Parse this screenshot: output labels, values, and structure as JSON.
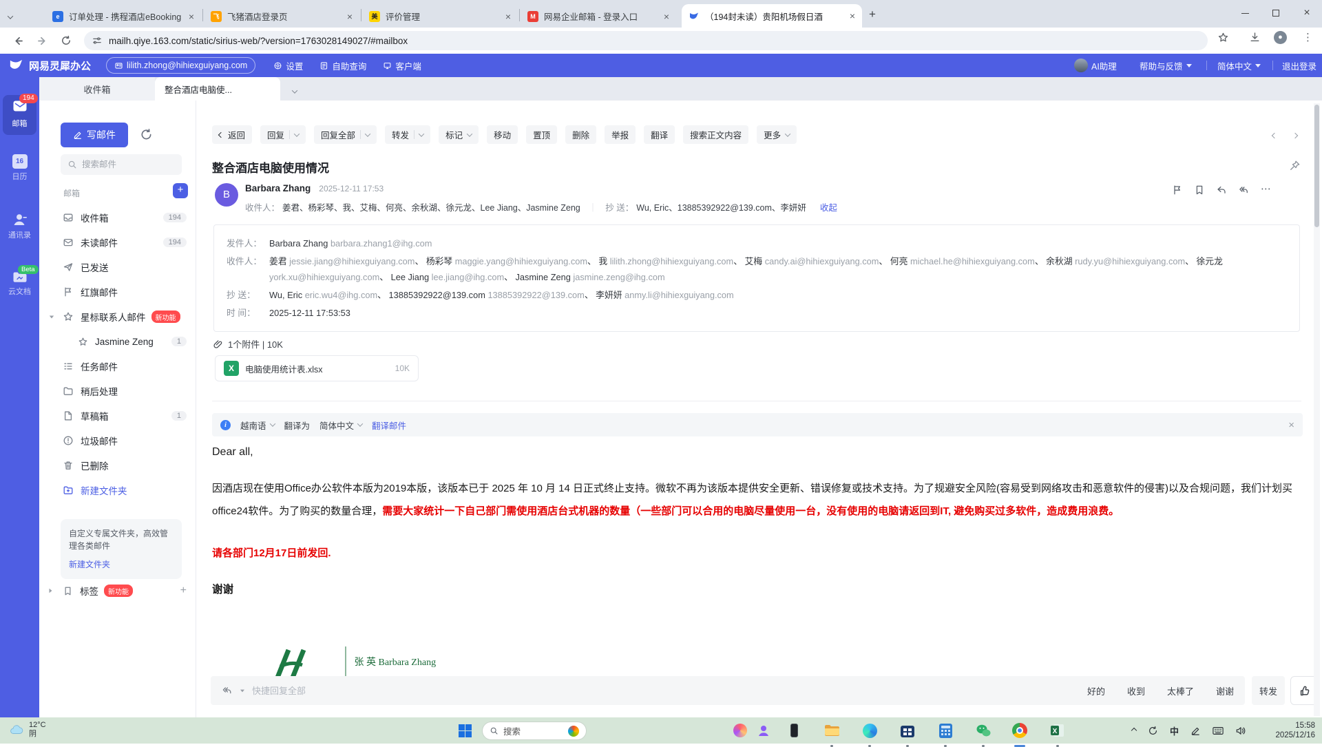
{
  "browser": {
    "tabs": [
      {
        "title": "订单处理 - 携程酒店eBooking"
      },
      {
        "title": "飞猪酒店登录页"
      },
      {
        "title": "评价管理"
      },
      {
        "title": "网易企业邮箱 - 登录入口"
      },
      {
        "title": "（194封未读）贵阳机场假日酒"
      }
    ],
    "url": "mailh.qiye.163.com/static/sirius-web/?version=1763028149027/#mailbox"
  },
  "header": {
    "brand": "网易灵犀办公",
    "account": "lilith.zhong@hihiexguiyang.com",
    "settings": "设置",
    "selfhelp": "自助查询",
    "client": "客户端",
    "ai": "AI助理",
    "help": "帮助与反馈",
    "lang": "简体中文",
    "logout": "退出登录"
  },
  "rail": {
    "mail": "邮箱",
    "mail_badge": "194",
    "calendar": "日历",
    "calendar_day": "16",
    "contacts": "通讯录",
    "docs": "云文档",
    "docs_badge": "Beta"
  },
  "mailtabs": {
    "inbox": "收件箱",
    "active": "整合酒店电脑使..."
  },
  "sidebar": {
    "compose": "写邮件",
    "search_placeholder": "搜索邮件",
    "section": "邮箱",
    "folders": [
      {
        "label": "收件箱",
        "count": "194"
      },
      {
        "label": "未读邮件",
        "count": "194"
      },
      {
        "label": "已发送"
      },
      {
        "label": "红旗邮件"
      },
      {
        "label": "星标联系人邮件",
        "badge": "新功能"
      },
      {
        "label": "Jasmine Zeng",
        "count": "1"
      },
      {
        "label": "任务邮件"
      },
      {
        "label": "稍后处理"
      },
      {
        "label": "草稿箱",
        "count": "1"
      },
      {
        "label": "垃圾邮件"
      },
      {
        "label": "已删除"
      },
      {
        "label": "新建文件夹"
      }
    ],
    "promo_text": "自定义专属文件夹，高效管理各类邮件",
    "promo_link": "新建文件夹",
    "tags": "标签",
    "tags_badge": "新功能"
  },
  "toolbar": {
    "back": "返回",
    "reply": "回复",
    "reply_all": "回复全部",
    "forward": "转发",
    "mark": "标记",
    "move": "移动",
    "pin_top": "置顶",
    "delete": "删除",
    "report": "举报",
    "translate": "翻译",
    "search_body": "搜索正文内容",
    "more": "更多"
  },
  "mail": {
    "subject": "整合酒店电脑使用情况",
    "avatar_initial": "B",
    "sender": "Barbara Zhang",
    "time_short": "2025-12-11 17:53",
    "to_label": "收件人：",
    "to_short": "姜君、杨彩琴、我、艾梅、何亮、余秋湖、徐元龙、Lee Jiang、Jasmine Zeng",
    "cc_label": "抄  送：",
    "cc_short": "Wu, Eric、13885392922@139.com、李妍妍",
    "collapse": "收起",
    "pipe": "｜",
    "sep": "、",
    "from_label": "发件人：",
    "from_name": "Barbara Zhang",
    "from_email": "barbara.zhang1@ihg.com",
    "to": [
      {
        "n": "姜君",
        "e": "jessie.jiang@hihiexguiyang.com"
      },
      {
        "n": "杨彩琴",
        "e": "maggie.yang@hihiexguiyang.com"
      },
      {
        "n": "我",
        "e": "lilith.zhong@hihiexguiyang.com"
      },
      {
        "n": "艾梅",
        "e": "candy.ai@hihiexguiyang.com"
      },
      {
        "n": "何亮",
        "e": "michael.he@hihiexguiyang.com"
      },
      {
        "n": "余秋湖",
        "e": "rudy.yu@hihiexguiyang.com"
      },
      {
        "n": "徐元龙",
        "e": "york.xu@hihiexguiyang.com"
      },
      {
        "n": "Lee Jiang",
        "e": "lee.jiang@ihg.com"
      },
      {
        "n": "Jasmine Zeng",
        "e": "jasmine.zeng@ihg.com"
      }
    ],
    "cc": [
      {
        "n": "Wu, Eric",
        "e": "eric.wu4@ihg.com"
      },
      {
        "n": "13885392922@139.com",
        "e": "13885392922@139.com"
      },
      {
        "n": "李妍妍",
        "e": "anmy.li@hihiexguiyang.com"
      }
    ],
    "time_label": "时  间：",
    "time_full": "2025-12-11 17:53:53",
    "attach_summary": "1个附件 | 10K",
    "attach_name": "电脑使用统计表.xlsx",
    "attach_size": "10K",
    "attach_ext": "X",
    "translate_bar": {
      "lang": "越南语",
      "to": "翻译为",
      "target": "简体中文",
      "action": "翻译邮件"
    },
    "body": {
      "greeting": "Dear all,",
      "p1": "因酒店现在使用Office办公软件本版为2019本版，该版本已于 2025 年 10 月 14 日正式终止支持。微软不再为该版本提供安全更新、错误修复或技术支持。为了规避安全风险(容易受到网络攻击和恶意软件的侵害)以及合规问题，我们计划买office24软件。为了购买的数量合理，",
      "p1_red": "需要大家统计一下自己部门需使用酒店台式机器的数量（一些部门可以合用的电脑尽量使用一台，没有使用的电脑请返回到IT, 避免购买过多软件，造成费用浪费。",
      "p2_red": "请各部门12月17日前发回.",
      "thanks": "谢谢",
      "signature": "张 英 Barbara Zhang"
    },
    "quick": {
      "placeholder": "快捷回复全部",
      "s1": "好的",
      "s2": "收到",
      "s3": "太棒了",
      "s4": "谢谢",
      "forward": "转发"
    }
  },
  "taskbar": {
    "temp": "12°C",
    "cond": "阴",
    "search": "搜索",
    "ime": "中",
    "time": "15:58",
    "date": "2025/12/16"
  }
}
